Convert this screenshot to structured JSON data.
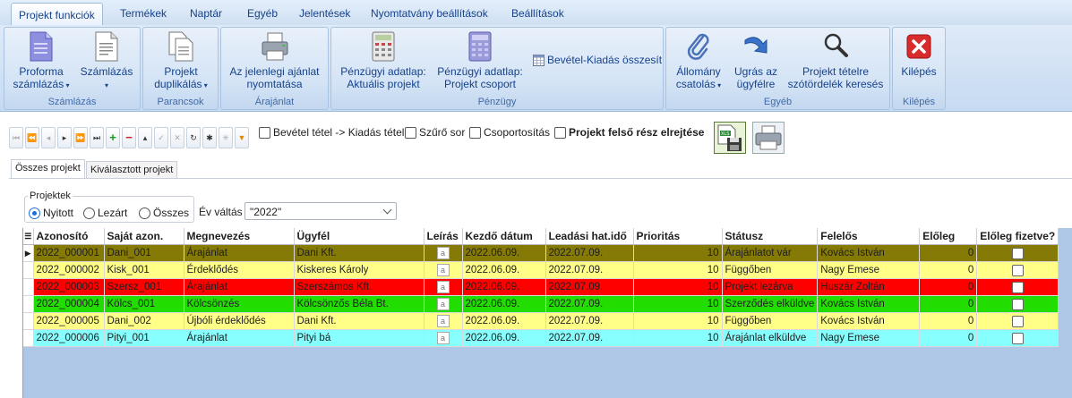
{
  "colors": {
    "row_olive": "#857a05",
    "row_yellow": "#ffff88",
    "row_red": "#ff0000",
    "row_green": "#22dd00",
    "row_cyan": "#88ffff",
    "accent": "#15428b"
  },
  "ribbon_tabs": [
    "Projekt funkciók",
    "Termékek",
    "Naptár",
    "Egyéb",
    "Jelentések",
    "Nyomtatvány beállítások",
    "Beállítások"
  ],
  "ribbon": {
    "szamlazas": {
      "label": "Számlázás",
      "proforma": "Proforma\nszámlázás",
      "szamlazas": "Számlázás"
    },
    "parancsok": {
      "label": "Parancsok",
      "duplikalas": "Projekt\nduplikálás"
    },
    "arajanlat": {
      "label": "Árajánlat",
      "nyomtatasa": "Az jelenlegi ajánlat\nnyomtatása"
    },
    "penzugy": {
      "label": "Pénzügy",
      "aktualis": "Pénzügyi adatlap:\nAktuális projekt",
      "csoport": "Pénzügyi adatlap:\nProjekt csoport",
      "osszesito": "Bevétel-Kiadás összesít"
    },
    "egyeb": {
      "label": "Egyéb",
      "allomany": "Állomány\ncsatolás",
      "ugras": "Ugrás az\nügyfélre",
      "kereses": "Projekt tételre\nszótördelék keresés"
    },
    "kilepes": {
      "label": "Kilépés",
      "kilepes": "Kilépés"
    }
  },
  "toolbar": {
    "bevetel_kiadas": "Bevétel tétel -> Kiadás tétel",
    "szuro_sor": "Szűrő sor",
    "csoportositas": "Csoportosítás",
    "felso_elrejtese": "Projekt felső rész elrejtése"
  },
  "subtabs": [
    "Összes projekt",
    "Kiválasztott projekt"
  ],
  "filter": {
    "legend": "Projektek",
    "options": [
      "Nyitott",
      "Lezárt",
      "Összes"
    ],
    "selected": "Nyitott",
    "ev_label": "Év váltás",
    "ev_value": "\"2022\""
  },
  "grid": {
    "columns": [
      "Azonosító",
      "Saját azon.",
      "Megnevezés",
      "Ügyfél",
      "Leírás",
      "Kezdő dátum",
      "Leadási hat.idő",
      "Prioritás",
      "Státusz",
      "Felelős",
      "Előleg",
      "Előleg fizetve?"
    ],
    "rows": [
      {
        "id": "2022_000001",
        "sajat": "Dani_001",
        "megnevezes": "Árajánlat",
        "ugyfel": "Dani Kft.",
        "kezdo": "2022.06.09.",
        "leadas": "2022.07.09.",
        "prioritas": "10",
        "statusz": "Árajánlatot vár",
        "felelos": "Kovács István",
        "eloleg": "0",
        "color": "#857a05",
        "selected": true
      },
      {
        "id": "2022_000002",
        "sajat": "Kisk_001",
        "megnevezes": "Érdeklődés",
        "ugyfel": "Kiskeres Károly",
        "kezdo": "2022.06.09.",
        "leadas": "2022.07.09.",
        "prioritas": "10",
        "statusz": "Függőben",
        "felelos": "Nagy Emese",
        "eloleg": "0",
        "color": "#ffff88",
        "selected": false
      },
      {
        "id": "2022_000003",
        "sajat": "Szersz_001",
        "megnevezes": "Árajánlat",
        "ugyfel": "Szerszámos Kft.",
        "kezdo": "2022.06.09.",
        "leadas": "2022.07.09.",
        "prioritas": "10",
        "statusz": "Projekt lezárva",
        "felelos": "Huszár Zoltán",
        "eloleg": "0",
        "color": "#ff0000",
        "selected": false
      },
      {
        "id": "2022_000004",
        "sajat": "Kölcs_001",
        "megnevezes": "Kölcsönzés",
        "ugyfel": "Kölcsönzős Béla Bt.",
        "kezdo": "2022.06.09.",
        "leadas": "2022.07.09.",
        "prioritas": "10",
        "statusz": "Szerződés elküldve",
        "felelos": "Kovács István",
        "eloleg": "0",
        "color": "#22dd00",
        "selected": false
      },
      {
        "id": "2022_000005",
        "sajat": "Dani_002",
        "megnevezes": "Újbóli érdeklődés",
        "ugyfel": "Dani Kft.",
        "kezdo": "2022.06.09.",
        "leadas": "2022.07.09.",
        "prioritas": "10",
        "statusz": "Függőben",
        "felelos": "Kovács István",
        "eloleg": "0",
        "color": "#ffff88",
        "selected": false
      },
      {
        "id": "2022_000006",
        "sajat": "Pityi_001",
        "megnevezes": "Árajánlat",
        "ugyfel": "Pityi bá",
        "kezdo": "2022.06.09.",
        "leadas": "2022.07.09.",
        "prioritas": "10",
        "statusz": "Árajánlat elküldve",
        "felelos": "Nagy Emese",
        "eloleg": "0",
        "color": "#88ffff",
        "selected": false
      }
    ]
  }
}
